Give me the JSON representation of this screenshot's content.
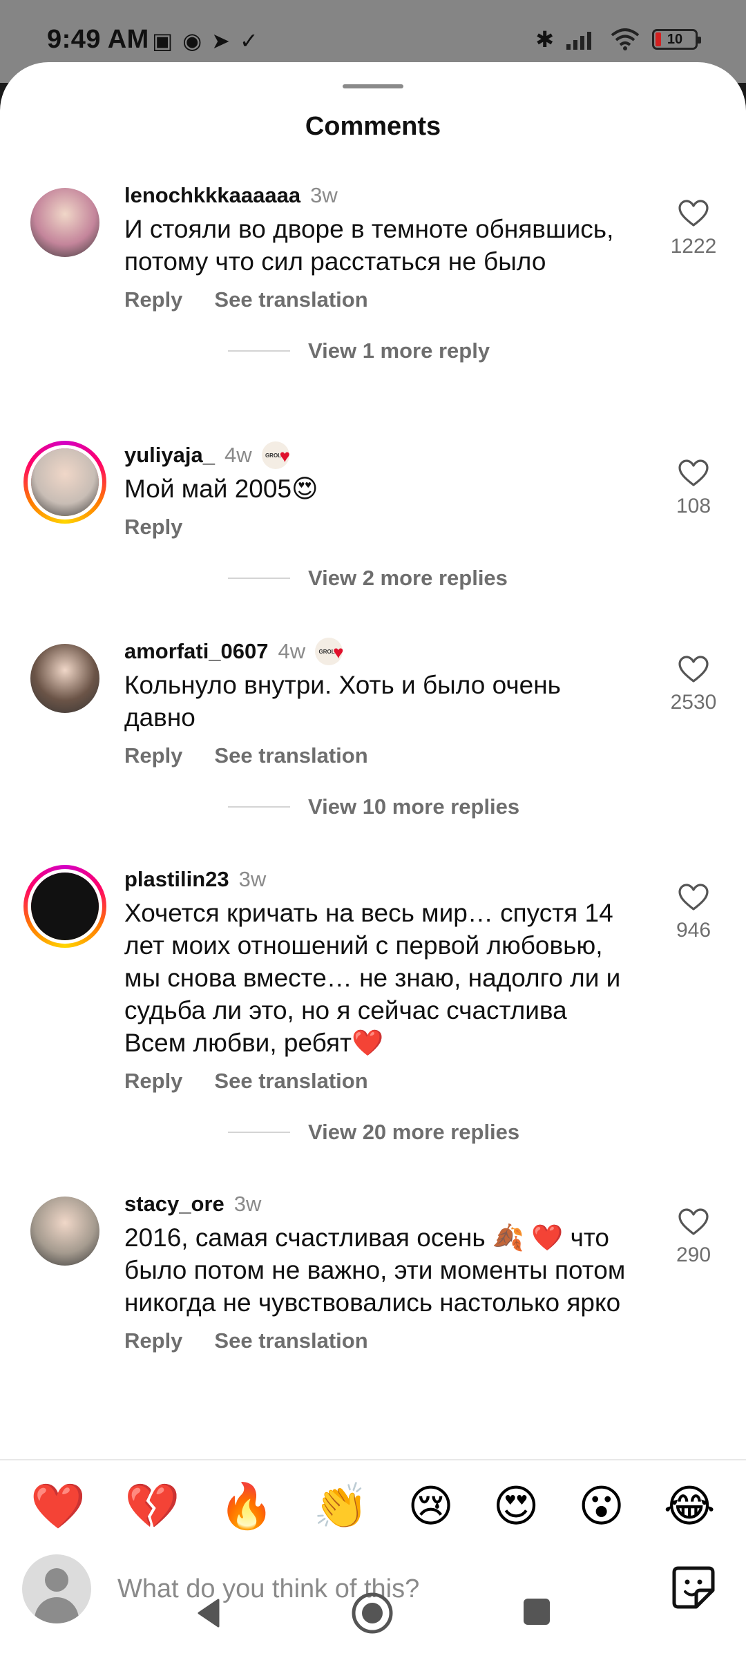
{
  "status_bar": {
    "time": "9:49 AM",
    "battery_level": "10"
  },
  "sheet": {
    "title": "Comments"
  },
  "comments": [
    {
      "username": "lenochkkkaaaaaa",
      "time": "3w",
      "verified_badge": false,
      "text": "И стояли во дворе в темноте обнявшись, потому что сил расстаться не было",
      "reply_label": "Reply",
      "translation_label": "See translation",
      "likes": "1222",
      "view_replies": "View 1 more reply",
      "avatar_color": "#c4859b"
    },
    {
      "username": "yuliyaja_",
      "time": "4w",
      "verified_badge": true,
      "text": "Мой май 2005😍",
      "reply_label": "Reply",
      "translation_label": "",
      "likes": "108",
      "view_replies": "View 2 more replies",
      "avatar_color": "#c8bdb5"
    },
    {
      "username": "amorfati_0607",
      "time": "4w",
      "verified_badge": true,
      "text": "Кольнуло внутри. Хоть и было очень давно",
      "reply_label": "Reply",
      "translation_label": "See translation",
      "likes": "2530",
      "view_replies": "View 10 more replies",
      "avatar_color": "#6b5447"
    },
    {
      "username": "plastilin23",
      "time": "3w",
      "verified_badge": false,
      "text": "Хочется кричать на весь мир… спустя 14 лет моих отношений с первой любовью, мы снова вместе… не знаю, надолго ли и судьба ли это, но я сейчас счастлива Всем любви, ребят❤️",
      "reply_label": "Reply",
      "translation_label": "See translation",
      "likes": "946",
      "view_replies": "View 20 more replies",
      "avatar_color": "#111111"
    },
    {
      "username": "stacy_ore",
      "time": "3w",
      "verified_badge": false,
      "text": "2016, самая счастливая осень 🍂 ❤️ что было потом не важно, эти моменты потом никогда не чувствовались настолько ярко",
      "reply_label": "Reply",
      "translation_label": "See translation",
      "likes": "290",
      "view_replies": "",
      "avatar_color": "#a59b8f"
    }
  ],
  "badge_text": "GROLO",
  "quick_reactions": [
    "❤️",
    "💔",
    "🔥",
    "👏",
    "😢",
    "😍",
    "😮",
    "😂"
  ],
  "composer": {
    "placeholder": "What do you think of this?"
  }
}
